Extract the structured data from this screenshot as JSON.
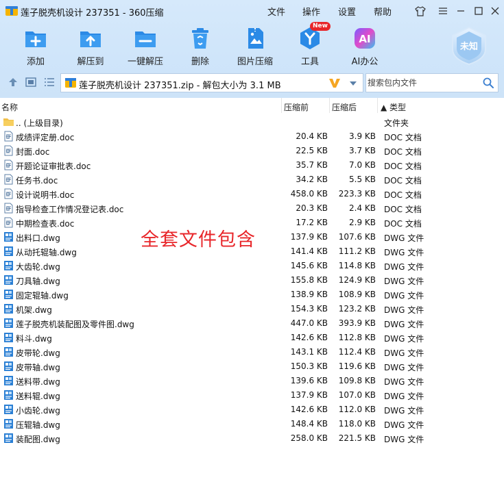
{
  "window": {
    "title": "莲子脱壳机设计 237351 - 360压缩",
    "menu": [
      "文件",
      "操作",
      "设置",
      "帮助"
    ]
  },
  "toolbar": {
    "items": [
      {
        "label": "添加",
        "icon": "add-folder-icon"
      },
      {
        "label": "解压到",
        "icon": "extract-to-icon"
      },
      {
        "label": "一键解压",
        "icon": "one-click-extract-icon"
      },
      {
        "label": "删除",
        "icon": "recycle-delete-icon"
      },
      {
        "label": "图片压缩",
        "icon": "image-compress-icon"
      },
      {
        "label": "工具",
        "icon": "tools-icon"
      },
      {
        "label": "AI办公",
        "icon": "ai-office-icon"
      }
    ],
    "new_badge": "New",
    "shield_text": "未知"
  },
  "address": {
    "text": "莲子脱壳机设计 237351.zip - 解包大小为 3.1 MB"
  },
  "search": {
    "placeholder": "搜索包内文件"
  },
  "columns": {
    "name": "名称",
    "size": "压缩前",
    "packed": "压缩后",
    "type": "▲ 类型"
  },
  "files": [
    {
      "name": ".. (上级目录)",
      "size": "",
      "packed": "",
      "type": "文件夹",
      "kind": "folder"
    },
    {
      "name": "成绩评定册.doc",
      "size": "20.4 KB",
      "packed": "3.9 KB",
      "type": "DOC 文档",
      "kind": "doc"
    },
    {
      "name": "封面.doc",
      "size": "22.5 KB",
      "packed": "3.7 KB",
      "type": "DOC 文档",
      "kind": "doc"
    },
    {
      "name": "开题论证审批表.doc",
      "size": "35.7 KB",
      "packed": "7.0 KB",
      "type": "DOC 文档",
      "kind": "doc"
    },
    {
      "name": "任务书.doc",
      "size": "34.2 KB",
      "packed": "5.5 KB",
      "type": "DOC 文档",
      "kind": "doc"
    },
    {
      "name": "设计说明书.doc",
      "size": "458.0 KB",
      "packed": "223.3 KB",
      "type": "DOC 文档",
      "kind": "doc"
    },
    {
      "name": "指导检查工作情况登记表.doc",
      "size": "20.3 KB",
      "packed": "2.4 KB",
      "type": "DOC 文档",
      "kind": "doc"
    },
    {
      "name": "中期检查表.doc",
      "size": "17.2 KB",
      "packed": "2.9 KB",
      "type": "DOC 文档",
      "kind": "doc"
    },
    {
      "name": "出料口.dwg",
      "size": "137.9 KB",
      "packed": "107.6 KB",
      "type": "DWG 文件",
      "kind": "dwg"
    },
    {
      "name": "从动托辊轴.dwg",
      "size": "141.4 KB",
      "packed": "111.2 KB",
      "type": "DWG 文件",
      "kind": "dwg"
    },
    {
      "name": "大齿轮.dwg",
      "size": "145.6 KB",
      "packed": "114.8 KB",
      "type": "DWG 文件",
      "kind": "dwg"
    },
    {
      "name": "刀具轴.dwg",
      "size": "155.8 KB",
      "packed": "124.9 KB",
      "type": "DWG 文件",
      "kind": "dwg"
    },
    {
      "name": "固定辊轴.dwg",
      "size": "138.9 KB",
      "packed": "108.9 KB",
      "type": "DWG 文件",
      "kind": "dwg"
    },
    {
      "name": "机架.dwg",
      "size": "154.3 KB",
      "packed": "123.2 KB",
      "type": "DWG 文件",
      "kind": "dwg"
    },
    {
      "name": "莲子脱壳机装配图及零件图.dwg",
      "size": "447.0 KB",
      "packed": "393.9 KB",
      "type": "DWG 文件",
      "kind": "dwg"
    },
    {
      "name": "料斗.dwg",
      "size": "142.6 KB",
      "packed": "112.8 KB",
      "type": "DWG 文件",
      "kind": "dwg"
    },
    {
      "name": "皮带轮.dwg",
      "size": "143.1 KB",
      "packed": "112.4 KB",
      "type": "DWG 文件",
      "kind": "dwg"
    },
    {
      "name": "皮带轴.dwg",
      "size": "150.3 KB",
      "packed": "119.6 KB",
      "type": "DWG 文件",
      "kind": "dwg"
    },
    {
      "name": "送料带.dwg",
      "size": "139.6 KB",
      "packed": "109.8 KB",
      "type": "DWG 文件",
      "kind": "dwg"
    },
    {
      "name": "送料辊.dwg",
      "size": "137.9 KB",
      "packed": "107.0 KB",
      "type": "DWG 文件",
      "kind": "dwg"
    },
    {
      "name": "小齿轮.dwg",
      "size": "142.6 KB",
      "packed": "112.0 KB",
      "type": "DWG 文件",
      "kind": "dwg"
    },
    {
      "name": "压辊轴.dwg",
      "size": "148.4 KB",
      "packed": "118.0 KB",
      "type": "DWG 文件",
      "kind": "dwg"
    },
    {
      "name": "装配图.dwg",
      "size": "258.0 KB",
      "packed": "221.5 KB",
      "type": "DWG 文件",
      "kind": "dwg"
    }
  ],
  "overlay": {
    "text": "全套文件包含"
  },
  "colors": {
    "accent": "#2b8ae6",
    "chrome_bg": "#d3e7fa",
    "overlay_red": "#e8262a",
    "v_logo": "#f5a623"
  }
}
